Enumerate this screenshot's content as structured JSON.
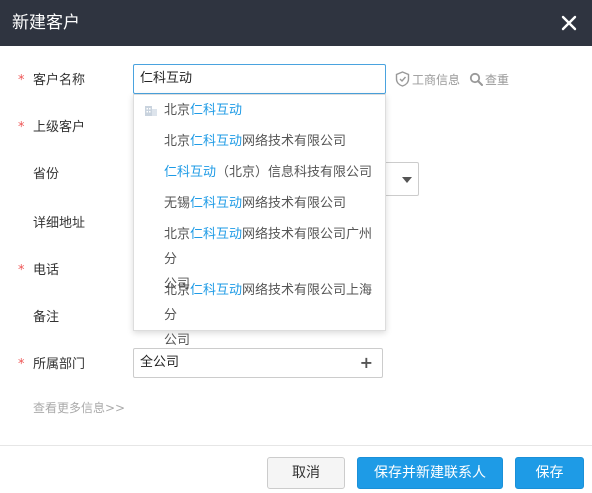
{
  "dialog": {
    "title": "新建客户"
  },
  "form": {
    "labels": {
      "name": "客户名称",
      "parent": "上级客户",
      "province": "省份",
      "address": "详细地址",
      "phone": "电话",
      "remark": "备注",
      "dept": "所属部门"
    },
    "required_mark": "*",
    "name_value": "仁科互动",
    "biz_info_label": "工商信息",
    "check_dup_label": "查重",
    "dept_value": "全公司",
    "dept_plus": "+",
    "more_info_link": "查看更多信息>>"
  },
  "suggestions": [
    {
      "prefix": "北京",
      "match": "仁科互动",
      "suffix": ""
    },
    {
      "prefix": "北京",
      "match": "仁科互动",
      "suffix": "网络技术有限公司"
    },
    {
      "prefix": "",
      "match": "仁科互动",
      "suffix": "（北京）信息科技有限公司"
    },
    {
      "prefix": "无锡",
      "match": "仁科互动",
      "suffix": "网络技术有限公司"
    },
    {
      "prefix": "北京",
      "match": "仁科互动",
      "suffix": "网络技术有限公司广州分",
      "line2": "公司"
    },
    {
      "prefix": "北京",
      "match": "仁科互动",
      "suffix": "网络技术有限公司上海分",
      "line2": "公司"
    }
  ],
  "buttons": {
    "cancel": "取消",
    "save_and_new_contact": "保存并新建联系人",
    "save": "保存"
  },
  "colors": {
    "title_bar": "#2f3440",
    "accent": "#1e9be6",
    "required": "#e55555"
  },
  "icons": {
    "close": "close-icon",
    "shield": "shield-icon",
    "search": "search-icon",
    "building": "building-icon",
    "dropdown_arrow": "chevron-down-icon"
  }
}
